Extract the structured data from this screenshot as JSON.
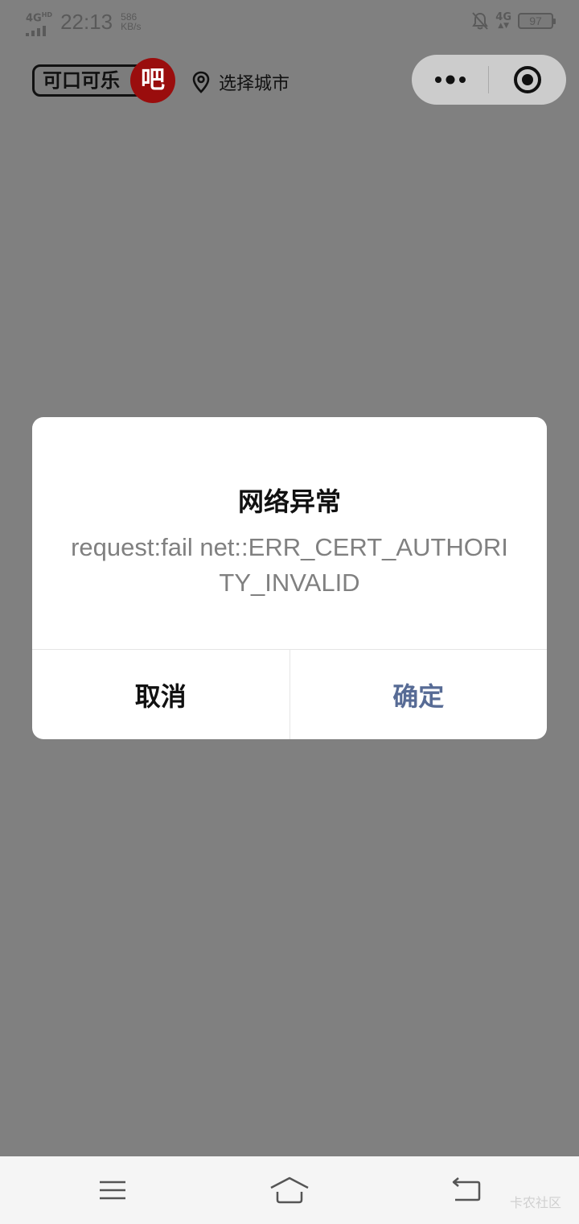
{
  "status_bar": {
    "network_left": "4G",
    "network_left_sup": "HD",
    "time": "22:13",
    "speed_value": "586",
    "speed_unit": "KB/s",
    "network_right": "4G",
    "battery": "97"
  },
  "header": {
    "logo_text": "可口可乐",
    "logo_badge": "吧",
    "city_label": "选择城市",
    "logo_badge_color": "#9a0d0d"
  },
  "dialog": {
    "title": "网络异常",
    "message": "request:fail net::ERR_CERT_AUTHORITY_INVALID",
    "cancel_label": "取消",
    "confirm_label": "确定",
    "confirm_color": "#576b95"
  },
  "nav_bar": {
    "watermark": "卡农社区",
    "icons": [
      "menu-icon",
      "home-icon",
      "back-icon"
    ]
  }
}
